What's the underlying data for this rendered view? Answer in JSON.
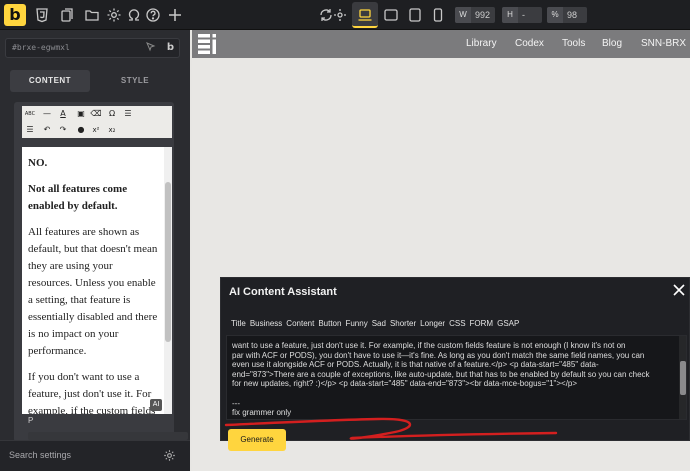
{
  "toolbar": {
    "logo": "b",
    "width_label": "W",
    "width_value": "992",
    "height_label": "H",
    "height_value": "-",
    "zoom_label": "%",
    "zoom_value": "98"
  },
  "sidebar": {
    "element_id": "#brxe-egwmxl",
    "tabs": [
      "CONTENT",
      "STYLE"
    ],
    "status_tag": "P",
    "ai_badge": "AI",
    "search_settings": "Search settings"
  },
  "editor": {
    "paragraphs": [
      {
        "text": "NO.",
        "bold": true
      },
      {
        "text": "Not all features come enabled by default.",
        "bold": true
      },
      {
        "text": "All features are shown as default, but that doesn't mean they are using your resources. Unless you enable a setting, that feature is essentially disabled and there is no impact on your performance.",
        "bold": false
      },
      {
        "text": "If you don't want to use a feature, just don't use it. For example, if the custom fields feature is not enough (I know it's not on par with",
        "bold": false
      }
    ]
  },
  "site": {
    "nav": [
      "Library",
      "Codex",
      "Tools",
      "Blog",
      "SNN-BRX"
    ]
  },
  "ai_modal": {
    "title": "AI Content Assistant",
    "chips": [
      "Title",
      "Business",
      "Content",
      "Button",
      "Funny",
      "Sad",
      "Shorter",
      "Longer",
      "CSS",
      "FORM",
      "GSAP"
    ],
    "text_lines": [
      "want to use a feature, just don't use it. For example, if the custom fields feature is not enough (I know it's not on",
      "par with ACF or PODS), you don't have to use it—it's fine. As long as you don't match the same field names, you can",
      "even use it alongside ACF or PODS. Actually, it is that native of a feature.</p> <p data-start=\"485\" data-",
      "end=\"873\">There are a couple of exceptions, like auto-update, but that has to be enabled by default so you can check",
      "for new updates, right? :)</p> <p data-start=\"485\" data-end=\"873\"><br data-mce-bogus=\"1\"></p>",
      "",
      "---",
      "fix grammer only"
    ],
    "generate_label": "Generate"
  },
  "colors": {
    "accent": "#ffd53e",
    "annotation": "#d31f1f"
  }
}
